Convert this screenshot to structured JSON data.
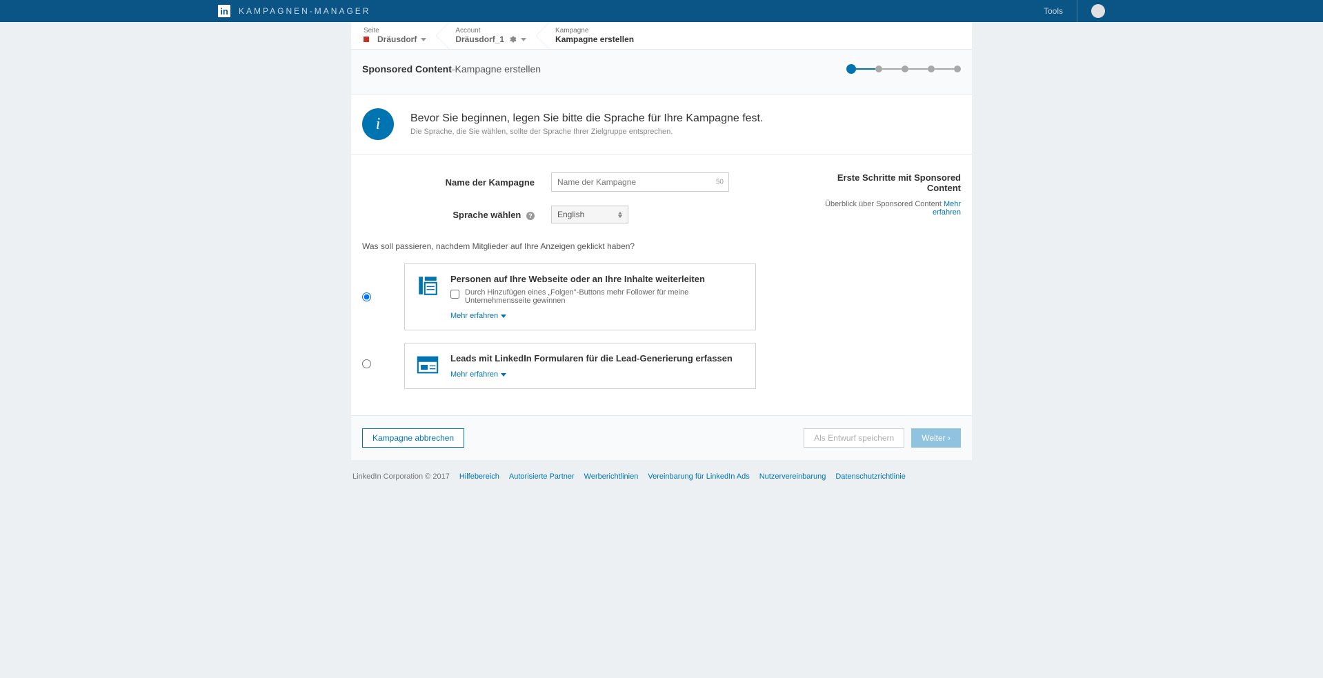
{
  "topbar": {
    "title": "KAMPAGNEN-MANAGER",
    "tools": "Tools"
  },
  "breadcrumb": {
    "seite_label": "Seite",
    "seite_value": "Dräusdorf",
    "account_label": "Account",
    "account_value": "Dräusdorf_1",
    "kampagne_label": "Kampagne",
    "kampagne_value": "Kampagne erstellen"
  },
  "page_title_bold": "Sponsored Content",
  "page_title_rest": "-Kampagne erstellen",
  "info": {
    "title": "Bevor Sie beginnen, legen Sie bitte die Sprache für Ihre Kampagne fest.",
    "sub": "Die Sprache, die Sie wählen, sollte der Sprache Ihrer Zielgruppe entsprechen."
  },
  "form": {
    "name_label": "Name der Kampagne",
    "name_placeholder": "Name der Kampagne",
    "name_counter": "50",
    "lang_label": "Sprache wählen",
    "lang_value": "English"
  },
  "side": {
    "title": "Erste Schritte mit Sponsored Content",
    "text": "Überblick über Sponsored Content ",
    "link": "Mehr erfahren"
  },
  "question": "Was soll passieren, nachdem Mitglieder auf Ihre Anzeigen geklickt haben?",
  "options": {
    "opt1_title": "Personen auf Ihre Webseite oder an Ihre Inhalte weiterleiten",
    "opt1_check": "Durch Hinzufügen eines „Folgen\"-Buttons mehr Follower für meine Unternehmensseite gewinnen",
    "opt2_title": "Leads mit LinkedIn Formularen für die Lead-Generierung erfassen",
    "learn_more": "Mehr erfahren"
  },
  "buttons": {
    "cancel": "Kampagne abbrechen",
    "draft": "Als Entwurf speichern",
    "next": "Weiter ›"
  },
  "footer": {
    "copyright": "LinkedIn Corporation © 2017",
    "links": [
      "Hilfebereich",
      "Autorisierte Partner",
      "Werberichtlinien",
      "Vereinbarung für LinkedIn Ads",
      "Nutzervereinbarung",
      "Datenschutzrichtlinie"
    ]
  }
}
